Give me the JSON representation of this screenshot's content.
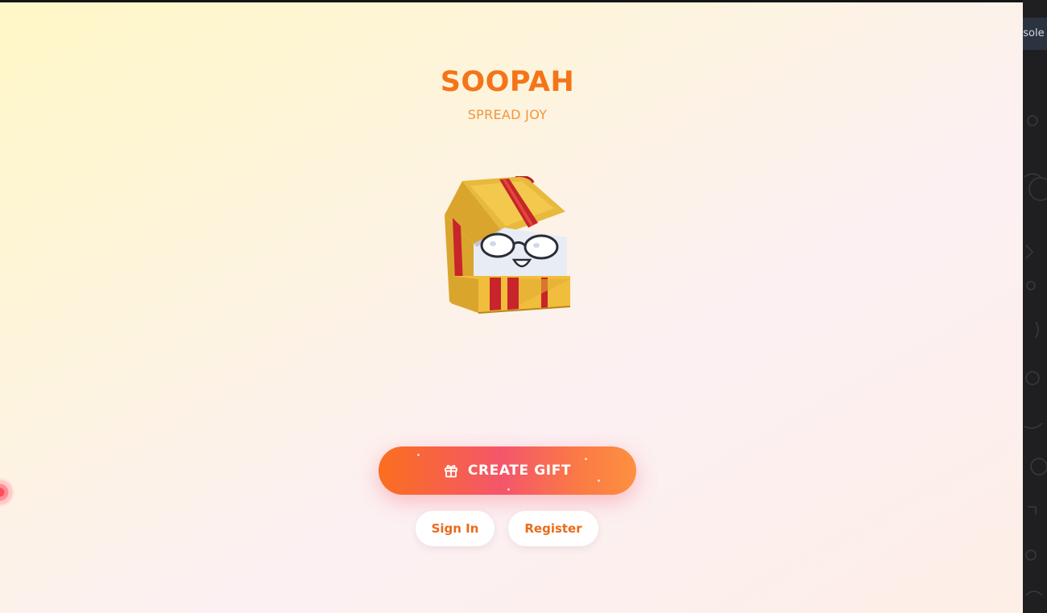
{
  "app": {
    "title": "SOOPAH",
    "tagline": "SPREAD JOY"
  },
  "actions": {
    "create_gift_label": "CREATE GIFT",
    "sign_in_label": "Sign In",
    "register_label": "Register"
  },
  "devtools": {
    "tab_label": "nsole"
  },
  "icons": {
    "create_gift": "gift-icon",
    "mascot": "gift-box-mascot"
  },
  "colors": {
    "brand_orange": "#f47519",
    "tagline_orange": "#f0953c",
    "button_gradient_start": "#fa6f1f",
    "button_gradient_mid": "#f4566a",
    "button_gradient_end": "#fd9040",
    "secondary_button_text": "#ea6b1a"
  }
}
